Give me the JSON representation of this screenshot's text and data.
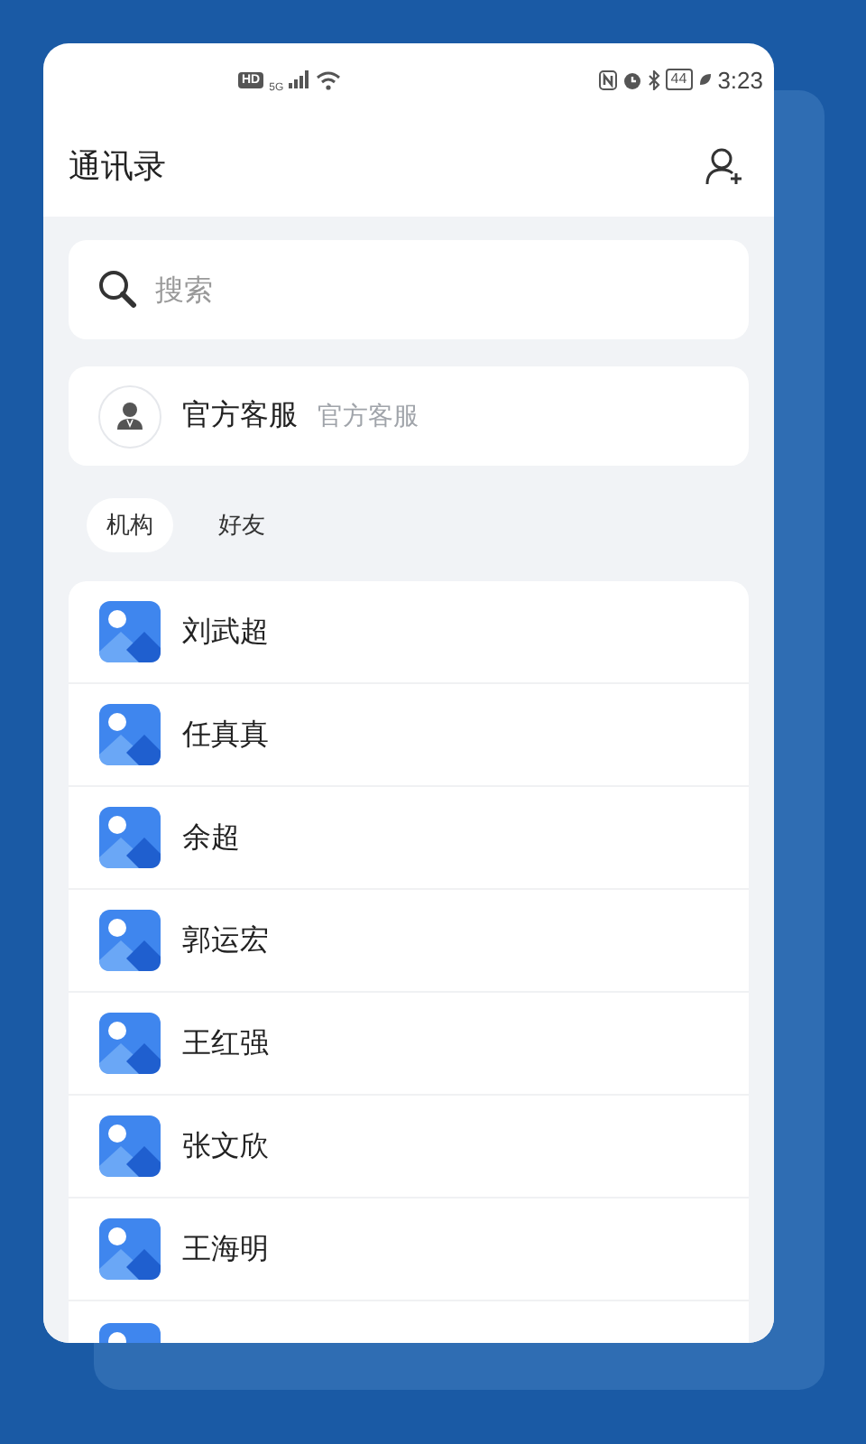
{
  "status_bar": {
    "hd": "HD",
    "network": "5G",
    "battery": "44",
    "time": "3:23"
  },
  "header": {
    "title": "通讯录"
  },
  "search": {
    "placeholder": "搜索"
  },
  "service": {
    "name": "官方客服",
    "subtitle": "官方客服"
  },
  "tabs": [
    {
      "label": "机构",
      "selected": true
    },
    {
      "label": "好友",
      "selected": false
    }
  ],
  "contacts": [
    {
      "kind": "named",
      "name": "刘武超"
    },
    {
      "kind": "named",
      "name": "任真真"
    },
    {
      "kind": "named",
      "name": "余超"
    },
    {
      "kind": "named",
      "name": "郭运宏"
    },
    {
      "kind": "named",
      "name": "王红强"
    },
    {
      "kind": "named",
      "name": "张文欣"
    },
    {
      "kind": "named",
      "name": "王海明"
    },
    {
      "kind": "cut_off"
    }
  ]
}
